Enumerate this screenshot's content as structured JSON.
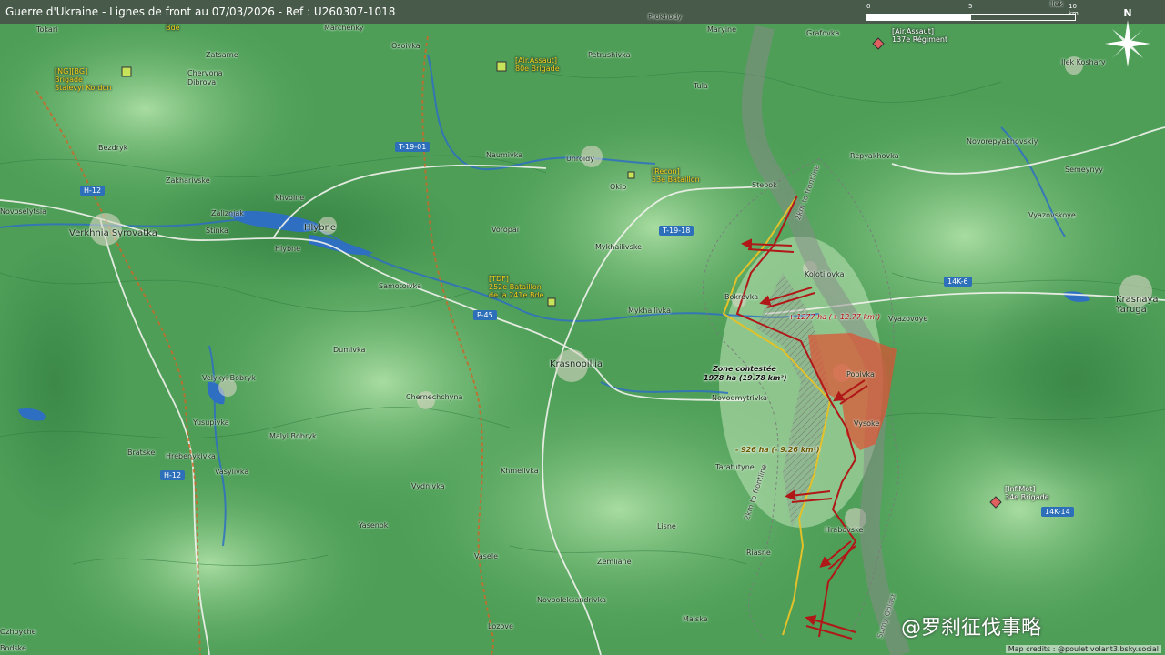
{
  "title": "Guerre d'Ukraine - Lignes de front au 07/03/2026 - Ref : U260307-1018",
  "scale": {
    "zero": "0",
    "mid": "5",
    "end": "10 km"
  },
  "compass": {
    "north": "N",
    "icon": "compass-rose-icon"
  },
  "colors": {
    "frontline": "#e2c12a",
    "attack": "#b01818",
    "gain": "#e05030",
    "water": "#2e6fc2",
    "road_sign": "#2d6fb8"
  },
  "roads": [
    "T-19-01",
    "H-12",
    "T-19-18",
    "P-45",
    "14K-6",
    "H-12",
    "14K-14"
  ],
  "places": [
    "Tokari",
    "Marchenky",
    "Osoivka",
    "Prokhody",
    "Maryine",
    "Grafovka",
    "Ilek",
    "Ilek Koshary",
    "Zatsarne",
    "Chervona Dibrova",
    "Petrushivka",
    "Tula",
    "Bezdryk",
    "Naumivka",
    "Uhroidy",
    "Okip",
    "Stepok",
    "Repyakhovka",
    "Novorepyakhovskiy",
    "Semeynyy",
    "Zakharivske",
    "Khvoine",
    "Zaliznjak",
    "Hlybne",
    "Stinka",
    "Verkhnia Syrovatka",
    "Hlybne",
    "Voropai",
    "Vyazovskoye",
    "Novoselytsia",
    "Samotoivka",
    "Mykhailivske",
    "Kolotilovka",
    "Bokrovka",
    "Mykhailivka",
    "Vyazovoye",
    "Krasnaya Yaruga",
    "Dumivka",
    "Krasnopillia",
    "Popivka",
    "Velykyi Bobryk",
    "Chernechchyna",
    "Novodmytrivka",
    "Vysoke",
    "Yusupivka",
    "Malyi Bobryk",
    "Bratske",
    "Hrebenykivka",
    "Vasylivka",
    "Taratutyne",
    "Khmelivka",
    "Vydnivka",
    "Hrabovske",
    "Yasenok",
    "Lisne",
    "Riasne",
    "Zemliane",
    "Vasele",
    "Novooleksandrivka",
    "Maiske",
    "Lozove",
    "Bodske",
    "Ozhoyche"
  ],
  "units": [
    {
      "tag": "[NG][BG]",
      "line2": "Brigade",
      "line3": "Stalevyi Kordon"
    },
    {
      "tag": "[Air.Assaut]",
      "line2": "80e Brigade"
    },
    {
      "tag": "[Recon]",
      "line2": "53e Bataillon"
    },
    {
      "tag": "[TDF]",
      "line2": "252e Bataillon",
      "line3": "de la 241e Bde"
    },
    {
      "tag": "[Air.Assaut]",
      "line2": "137e Régiment"
    },
    {
      "tag": "[Inf.Mot]",
      "line2": "34e Brigade"
    }
  ],
  "annotations": {
    "gain": "+ 1277 ha (+ 12.77 km²)",
    "contested_1": "Zone contestée",
    "contested_2": "1978 ha (19.78 km²)",
    "loss": "- 926 ha (- 9.26 km²)",
    "buffer_top": "2km to frontline",
    "buffer_left": "2km to frontline",
    "oblast": "Sumy Oblast",
    "fragment": "Bde"
  },
  "watermark": "@罗刹征伐事略",
  "credits": "Map credits : @poulet volant3.bsky.social"
}
